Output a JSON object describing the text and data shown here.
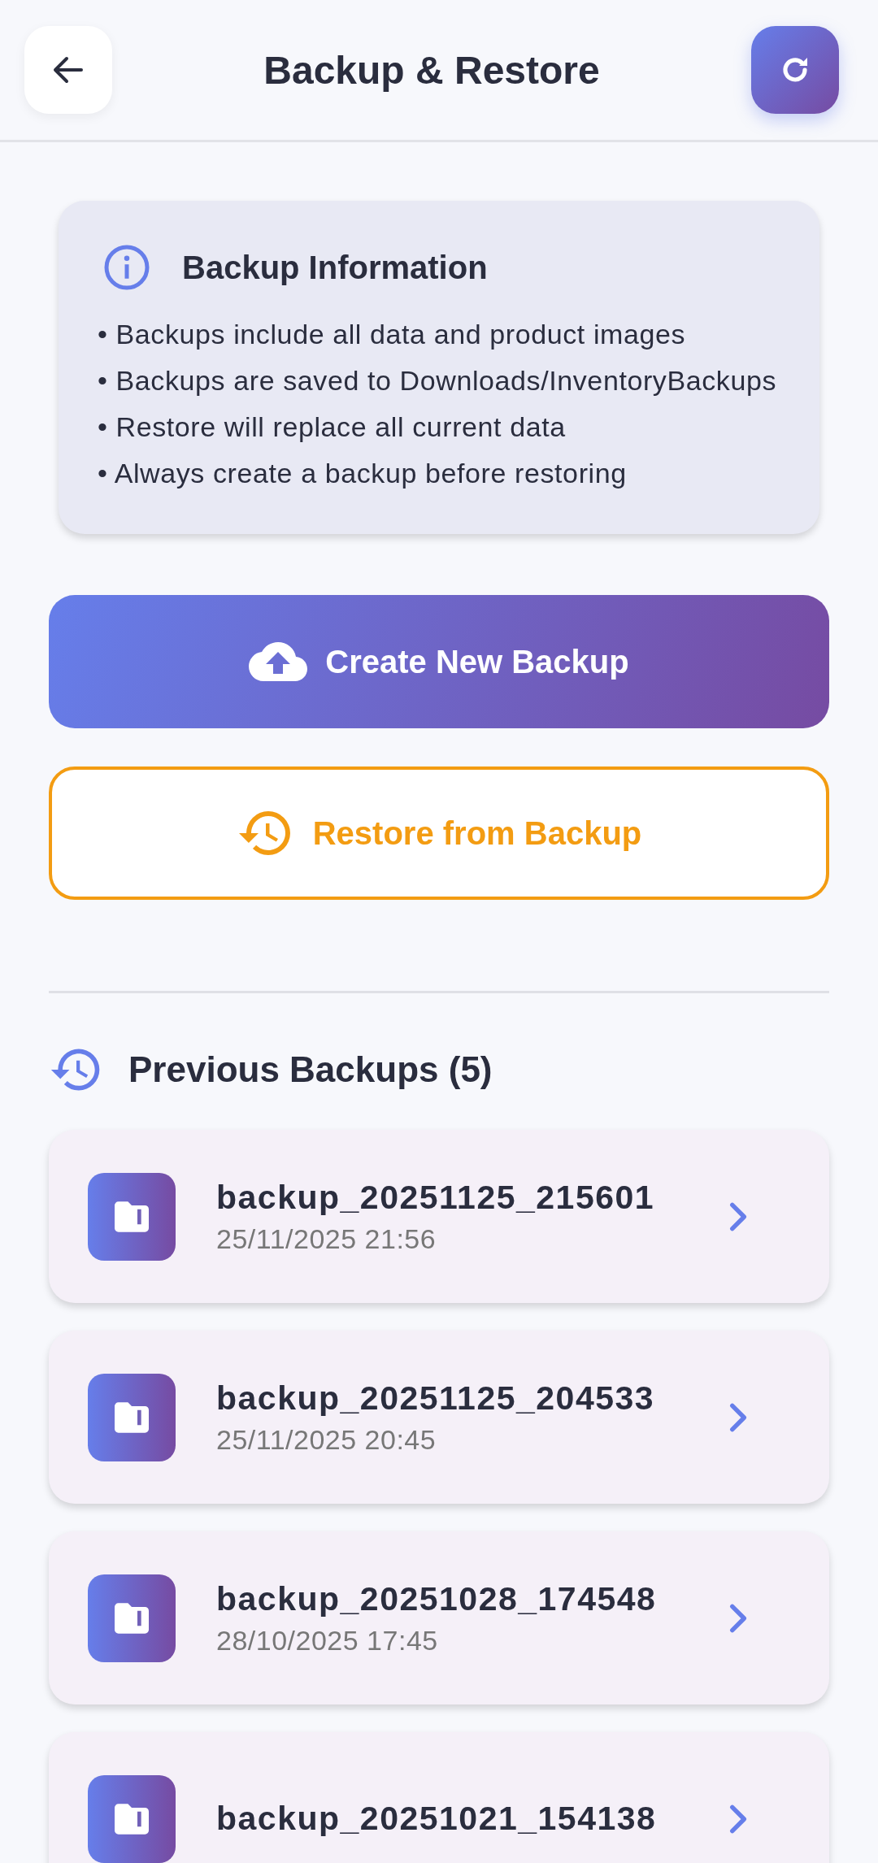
{
  "header": {
    "title": "Backup & Restore"
  },
  "info": {
    "title": "Backup Information",
    "lines": [
      "• Backups include all data and product images",
      "• Backups are saved to Downloads/InventoryBackups",
      "• Restore will replace all current data",
      "• Always create a backup before restoring"
    ]
  },
  "actions": [
    {
      "kind": "primary",
      "label": "Create New Backup"
    },
    {
      "kind": "outline",
      "label": "Restore from Backup"
    }
  ],
  "previous": {
    "title": "Previous Backups (5)",
    "items": [
      {
        "name": "backup_20251125_215601",
        "date": "25/11/2025 21:56"
      },
      {
        "name": "backup_20251125_204533",
        "date": "25/11/2025 20:45"
      },
      {
        "name": "backup_20251028_174548",
        "date": "28/10/2025 17:45"
      },
      {
        "name": "backup_20251021_154138"
      }
    ]
  }
}
